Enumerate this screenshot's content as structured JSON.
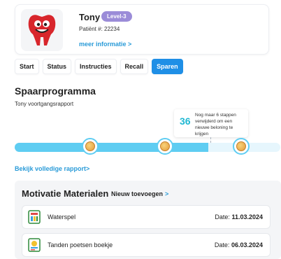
{
  "patient": {
    "name": "Tony",
    "level": "Level-3",
    "patient_number": "Patiënt #: 22234",
    "more_info": "meer informatie >",
    "avatar_icon": "red-tooth-mascot-icon"
  },
  "tabs": [
    {
      "label": "Start",
      "active": false
    },
    {
      "label": "Status",
      "active": false
    },
    {
      "label": "Instructies",
      "active": false
    },
    {
      "label": "Recall",
      "active": false
    },
    {
      "label": "Sparen",
      "active": true
    }
  ],
  "savings": {
    "title": "Spaarprogramma",
    "subtitle": "Tony voortgangsrapport",
    "tip_number": "36",
    "tip_text": "Nog maar 6 stappen verwijderd om een nieuwe beloning te krijgen",
    "progress_fraction": 0.73,
    "milestones": 3,
    "report_link": "Bekijk volledige rapport>"
  },
  "materials": {
    "title": "Motivatie Materialen",
    "add_new": "Nieuw toevoegen",
    "add_chevron": ">",
    "items": [
      {
        "name": "Waterspel",
        "date_label": "Date:",
        "date": "11.03.2024",
        "icon": "game-box-icon"
      },
      {
        "name": "Tanden poetsen boekje",
        "date_label": "Date:",
        "date": "06.03.2024",
        "icon": "booklet-icon"
      }
    ]
  },
  "colors": {
    "accent": "#1f8fe6",
    "link": "#2a9bd8",
    "progress": "#5fcdf2",
    "level_badge": "#9b8cd8"
  }
}
